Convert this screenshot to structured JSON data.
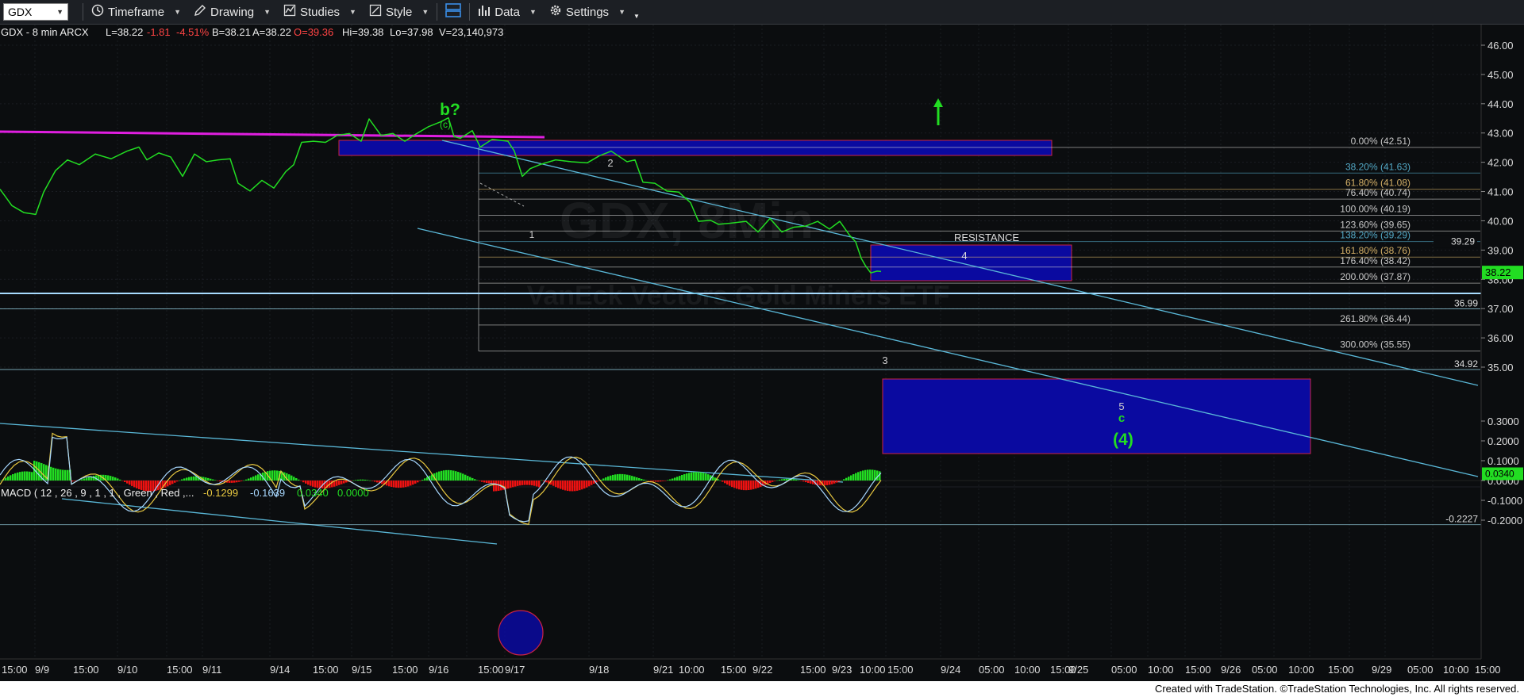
{
  "toolbar": {
    "symbol": "GDX",
    "timeframe_label": "Timeframe",
    "drawing_label": "Drawing",
    "studies_label": "Studies",
    "style_label": "Style",
    "data_label": "Data",
    "settings_label": "Settings"
  },
  "header": {
    "symbol_info": "GDX - 8 min  ARCX",
    "last": "L=38.22",
    "change": "-1.81",
    "change_pct": "-4.51%",
    "bid": "B=38.21",
    "ask": "A=38.22",
    "open": "O=39.36",
    "high": "Hi=39.38",
    "low": "Lo=37.98",
    "volume": "V=23,140,973"
  },
  "watermark": {
    "line1": "GDX, 8Min",
    "line2": "VanEck Vectors Gold Miners ETF"
  },
  "colors": {
    "background": "#0b0d0f",
    "price": "#22dd22",
    "fib_line": "#8fa8b8",
    "channel": "#5ab8d8",
    "magenta": "#e01ee0",
    "box_fill": "#0a0aa0",
    "box_border": "#cc2244",
    "label_green": "#22dd22",
    "hist_pos": "#22dd22",
    "hist_neg": "#ee1111",
    "macd_line": "#e8c840",
    "signal_line": "#a8d8ff"
  },
  "chart_data": {
    "type": "line",
    "price_axis": {
      "ticks": [
        "46.00",
        "45.00",
        "44.00",
        "43.00",
        "42.00",
        "41.00",
        "40.00",
        "39.00",
        "38.00",
        "37.00",
        "36.00",
        "35.00"
      ],
      "ylim": [
        34.2,
        46.6
      ],
      "last_price": "38.22",
      "overlay_label": "39.29"
    },
    "time_axis": {
      "labels": [
        "15:00",
        "9/9",
        "15:00",
        "9/10",
        "15:00",
        "9/11",
        "9/14",
        "15:00",
        "9/15",
        "15:00",
        "9/16",
        "15:00",
        "9/17",
        "9/18",
        "9/21",
        "10:00",
        "15:00",
        "9/22",
        "15:00",
        "9/23",
        "10:00",
        "15:00",
        "9/24",
        "05:00",
        "10:00",
        "15:00",
        "9/25",
        "05:00",
        "10:00",
        "15:00",
        "9/26",
        "05:00",
        "10:00",
        "15:00",
        "9/29",
        "05:00",
        "10:00",
        "15:00"
      ]
    },
    "fib_levels": [
      {
        "label": "0.00% (42.51)",
        "value": 42.51,
        "color": "#dddddd"
      },
      {
        "label": "38.20% (41.63)",
        "value": 41.63,
        "color": "#5ab8d8"
      },
      {
        "label": "61.80% (41.08)",
        "value": 41.08,
        "color": "#e8c070"
      },
      {
        "label": "76.40% (40.74)",
        "value": 40.74,
        "color": "#dddddd"
      },
      {
        "label": "100.00% (40.19)",
        "value": 40.19,
        "color": "#dddddd"
      },
      {
        "label": "123.60% (39.65)",
        "value": 39.65,
        "color": "#dddddd"
      },
      {
        "label": "138.20% (39.29)",
        "value": 39.29,
        "color": "#5ab8d8"
      },
      {
        "label": "161.80% (38.76)",
        "value": 38.76,
        "color": "#e8c070"
      },
      {
        "label": "176.40% (38.42)",
        "value": 38.42,
        "color": "#dddddd"
      },
      {
        "label": "200.00% (37.87)",
        "value": 37.87,
        "color": "#dddddd"
      },
      {
        "label": "261.80% (36.44)",
        "value": 36.44,
        "color": "#dddddd"
      },
      {
        "label": "300.00% (35.55)",
        "value": 35.55,
        "color": "#dddddd"
      }
    ],
    "horizontal_levels": [
      {
        "label": "36.99",
        "value": 36.99
      },
      {
        "label": "34.92",
        "value": 34.92
      }
    ],
    "annotations": {
      "b_wave": "b?",
      "c_small": "(c)",
      "wave1": "1",
      "wave2": "2",
      "wave3": "3",
      "wave4": "4",
      "wave5": "5",
      "c_target": "c",
      "wave_4_major": "(4)",
      "resistance": "RESISTANCE"
    },
    "macd": {
      "title": "MACD ( 12 , 26 , 9 , 1 , 1 , Green , Red ,...",
      "macd_value": "-0.1299",
      "signal_value": "-0.1639",
      "hist_value": "0.0340",
      "zero_value": "0.0000",
      "ticks": [
        "0.3000",
        "0.2000",
        "0.1000",
        "0.0000",
        "-0.1000",
        "-0.2000"
      ],
      "ylim": [
        -0.27,
        0.37
      ],
      "current_label": "0.0340",
      "level_label": "-0.2227",
      "level_value": -0.2227
    }
  },
  "footer": {
    "text": "Created with TradeStation. ©TradeStation Technologies, Inc. All rights reserved."
  }
}
